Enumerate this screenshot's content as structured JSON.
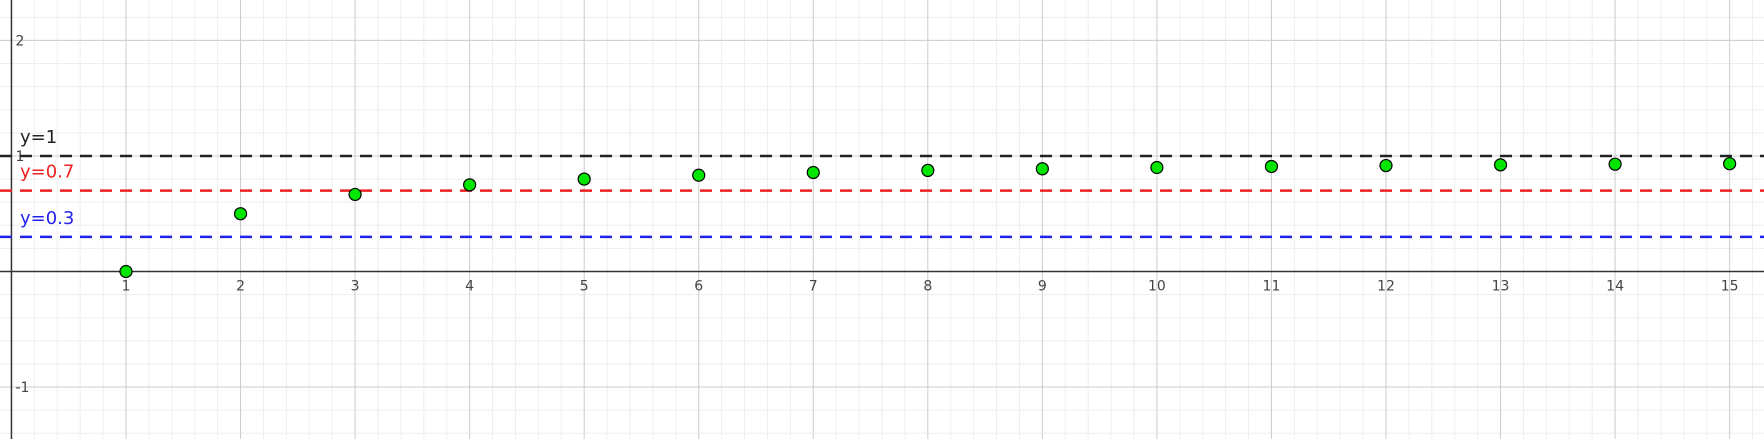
{
  "chart_data": {
    "type": "scatter",
    "xlim": [
      -0.1,
      15.3
    ],
    "ylim": [
      -1.45,
      2.35
    ],
    "grid": "major and minor",
    "x_ticks": [
      1,
      2,
      3,
      4,
      5,
      6,
      7,
      8,
      9,
      10,
      11,
      12,
      13,
      14,
      15
    ],
    "y_ticks": [
      -1,
      1,
      2
    ],
    "series": [
      {
        "marker_color": "#00e600",
        "x": [
          1,
          2,
          3,
          4,
          5,
          6,
          7,
          8,
          9,
          10,
          11,
          12,
          13,
          14,
          15
        ],
        "y": [
          0,
          0.5,
          0.667,
          0.75,
          0.8,
          0.833,
          0.857,
          0.875,
          0.889,
          0.9,
          0.909,
          0.917,
          0.923,
          0.929,
          0.933
        ]
      }
    ],
    "reference_lines": [
      {
        "y": 1,
        "label": "y=1",
        "color": "#222222"
      },
      {
        "y": 0.7,
        "label": "y=0.7",
        "color": "#ee2222"
      },
      {
        "y": 0.3,
        "label": "y=0.3",
        "color": "#2222ee"
      }
    ]
  }
}
